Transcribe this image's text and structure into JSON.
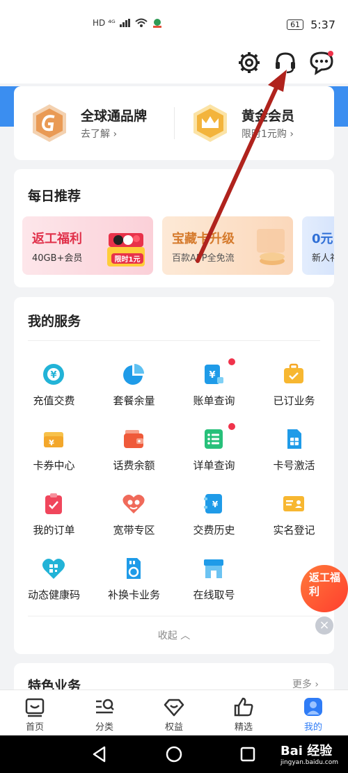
{
  "status_bar": {
    "signal_text": "HD ⁴ᴳ",
    "battery": "61",
    "time": "5:37"
  },
  "brand": [
    {
      "title": "全球通品牌",
      "subtitle": "去了解 ›"
    },
    {
      "title": "黄金会员",
      "subtitle": "限时1元购 ›"
    }
  ],
  "recommend": {
    "title": "每日推荐",
    "banners": [
      {
        "title": "返工福利",
        "subtitle": "40GB+会员",
        "badge": "限时1元"
      },
      {
        "title": "宝藏卡升级",
        "subtitle": "百款APP全免流"
      },
      {
        "title": "0元",
        "subtitle": "新人礼"
      }
    ]
  },
  "services": {
    "title": "我的服务",
    "items": [
      {
        "label": "充值交费",
        "icon": "recharge-icon"
      },
      {
        "label": "套餐余量",
        "icon": "pie-chart-icon"
      },
      {
        "label": "账单查询",
        "icon": "bill-icon"
      },
      {
        "label": "已订业务",
        "icon": "briefcase-icon"
      },
      {
        "label": "卡券中心",
        "icon": "coupon-icon"
      },
      {
        "label": "话费余额",
        "icon": "wallet-icon"
      },
      {
        "label": "详单查询",
        "icon": "list-icon"
      },
      {
        "label": "卡号激活",
        "icon": "sim-card-icon"
      },
      {
        "label": "我的订单",
        "icon": "order-icon"
      },
      {
        "label": "宽带专区",
        "icon": "broadband-icon"
      },
      {
        "label": "交费历史",
        "icon": "history-icon"
      },
      {
        "label": "实名登记",
        "icon": "id-card-icon"
      },
      {
        "label": "动态健康码",
        "icon": "health-code-icon"
      },
      {
        "label": "补换卡业务",
        "icon": "replace-card-icon"
      },
      {
        "label": "在线取号",
        "icon": "store-icon"
      }
    ],
    "collapse_label": "收起 ︿"
  },
  "special": {
    "title": "特色业务",
    "more": "更多 ›"
  },
  "float_promo": {
    "text": "返工福利"
  },
  "tabs": [
    {
      "label": "首页",
      "icon": "home-icon"
    },
    {
      "label": "分类",
      "icon": "category-icon"
    },
    {
      "label": "权益",
      "icon": "diamond-icon"
    },
    {
      "label": "精选",
      "icon": "thumbs-up-icon"
    },
    {
      "label": "我的",
      "icon": "profile-icon"
    }
  ],
  "active_tab": "我的",
  "watermark": {
    "brand": "Bai 经验",
    "url": "jingyan.baidu.com"
  },
  "colors": {
    "accent": "#2f7cf6",
    "arrow": "#b0231d",
    "red_dot": "#f0334b"
  }
}
